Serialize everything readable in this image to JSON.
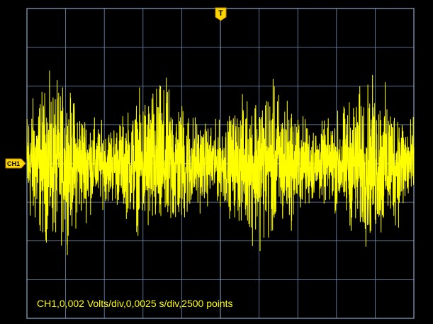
{
  "trigger": {
    "label": "T",
    "color": "#ffd700"
  },
  "channel": {
    "label": "CH1",
    "color": "#ffd700",
    "trace_color": "#ffff00"
  },
  "status": {
    "text": "CH1,0,002 Volts/div,0,0025 s/div,2500 points"
  },
  "display": {
    "background": "#000000",
    "grid_color": "#6b8cb0",
    "frame_color": "#8ea8c8",
    "h_divisions": 10,
    "v_divisions": 8
  },
  "chart_data": {
    "type": "line",
    "title": "",
    "xlabel": "",
    "ylabel": "",
    "points": 2500,
    "volts_per_div": 0.002,
    "seconds_per_div": 0.0025,
    "xlim": [
      0,
      0.025
    ],
    "ylim": [
      -0.008,
      0.008
    ],
    "signal": "random noise",
    "noise_peak_divisions": 2.7,
    "dc_offset_divisions": 0.0,
    "grid": true
  }
}
